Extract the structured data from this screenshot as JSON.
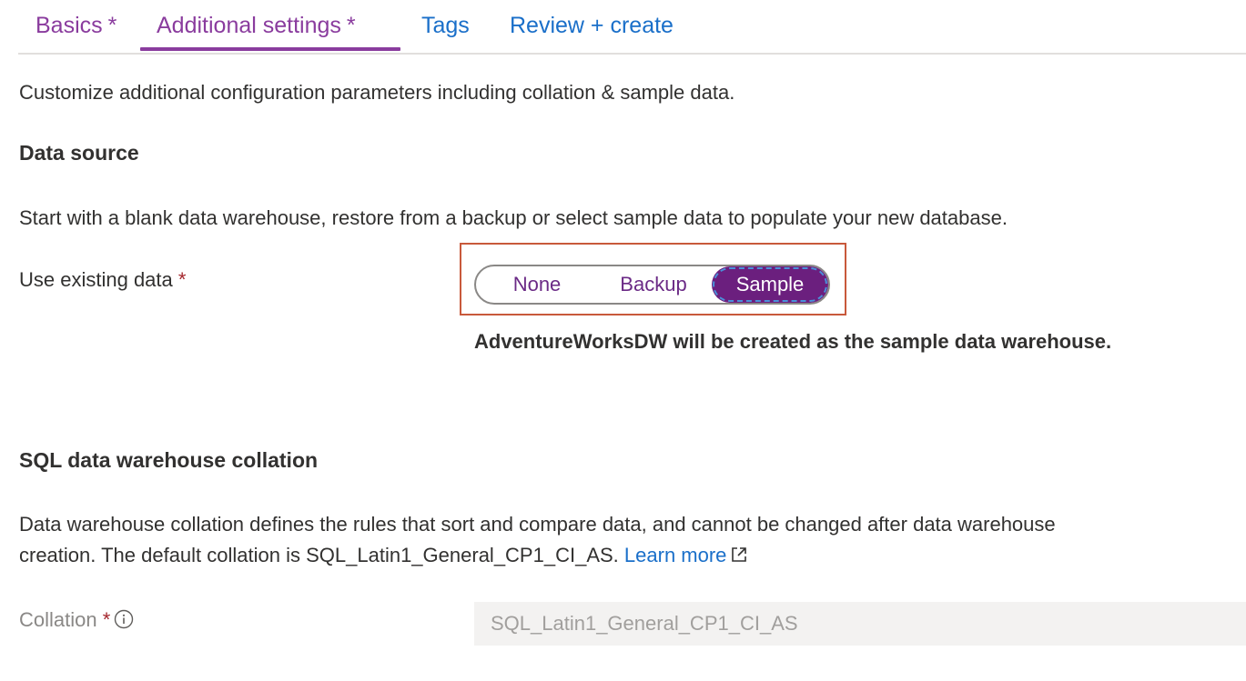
{
  "tabs": [
    {
      "label": "Basics",
      "required_marker": "*"
    },
    {
      "label": "Additional settings",
      "required_marker": "*"
    },
    {
      "label": "Tags"
    },
    {
      "label": "Review + create"
    }
  ],
  "intro_text": "Customize additional configuration parameters including collation & sample data.",
  "data_source": {
    "heading": "Data source",
    "description": "Start with a blank data warehouse, restore from a backup or select sample data to populate your new database.",
    "field_label": "Use existing data",
    "required_marker": "*",
    "options": [
      "None",
      "Backup",
      "Sample"
    ],
    "selected": "Sample",
    "note": "AdventureWorksDW will be created as the sample data warehouse."
  },
  "collation_section": {
    "heading": "SQL data warehouse collation",
    "description_line1": "Data warehouse collation defines the rules that sort and compare data, and cannot be changed after data warehouse",
    "description_line2": "creation. The default collation is SQL_Latin1_General_CP1_CI_AS.",
    "learn_more": "Learn more",
    "field_label": "Collation",
    "required_marker": "*",
    "value": "SQL_Latin1_General_CP1_CI_AS"
  },
  "colors": {
    "accent_purple": "#8a3c9e",
    "selected_fill": "#6b1f7e",
    "link_blue": "#1a6fc9",
    "highlight_border": "#c8593b",
    "required_red": "#a4262c"
  },
  "icons": {
    "external_link": "external-link-icon",
    "info": "info-icon"
  }
}
